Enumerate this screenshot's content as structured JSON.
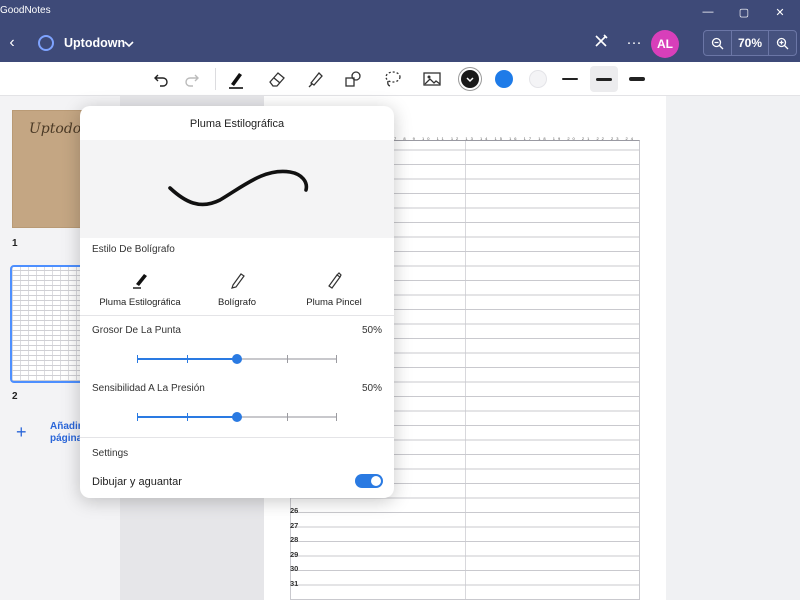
{
  "titlebar": {
    "app_title": "GoodNotes",
    "minimize": "—",
    "maximize": "▢",
    "close": "✕"
  },
  "header": {
    "back": "‹",
    "document_title": "Uptodown",
    "more": "···",
    "avatar_initials": "AL",
    "zoom_level": "70%",
    "zoom_out": "−",
    "zoom_in": "+"
  },
  "toolbar": {
    "undo": "↶",
    "redo": "↷",
    "tools": [
      "pen-icon",
      "eraser-icon",
      "highlighter-icon",
      "shapes-icon",
      "lasso-icon",
      "image-icon"
    ],
    "colors": [
      "#1a1a1a",
      "#1e7be8",
      "#f4f4f6"
    ],
    "accent": "#2a7ae2"
  },
  "sidebar": {
    "pages": [
      {
        "number": "1",
        "thumb_text": "Uptodown"
      },
      {
        "number": "2"
      }
    ],
    "add_page_label": "Añadir página"
  },
  "page": {
    "row_numbers": [
      "26",
      "27",
      "28",
      "29",
      "30",
      "31"
    ],
    "ruler_text": "7 8 9 10 11 12 13 14 15 16 17 18 19 20 21 22 23 24"
  },
  "popover": {
    "title": "Pluma Estilográfica",
    "pen_style_label": "Estilo De Bolígrafo",
    "styles": [
      {
        "label": "Pluma Estilográfica",
        "selected": true
      },
      {
        "label": "Bolígrafo",
        "selected": false
      },
      {
        "label": "Pluma Pincel",
        "selected": false
      }
    ],
    "tip_thickness_label": "Grosor De La Punta",
    "tip_thickness_value": "50%",
    "tip_thickness_level": 0.5,
    "pressure_label": "Sensibilidad A La Presión",
    "pressure_value": "50%",
    "pressure_level": 0.5,
    "settings_label": "Settings",
    "draw_hold_label": "Dibujar y aguantar",
    "draw_hold_on": true
  }
}
